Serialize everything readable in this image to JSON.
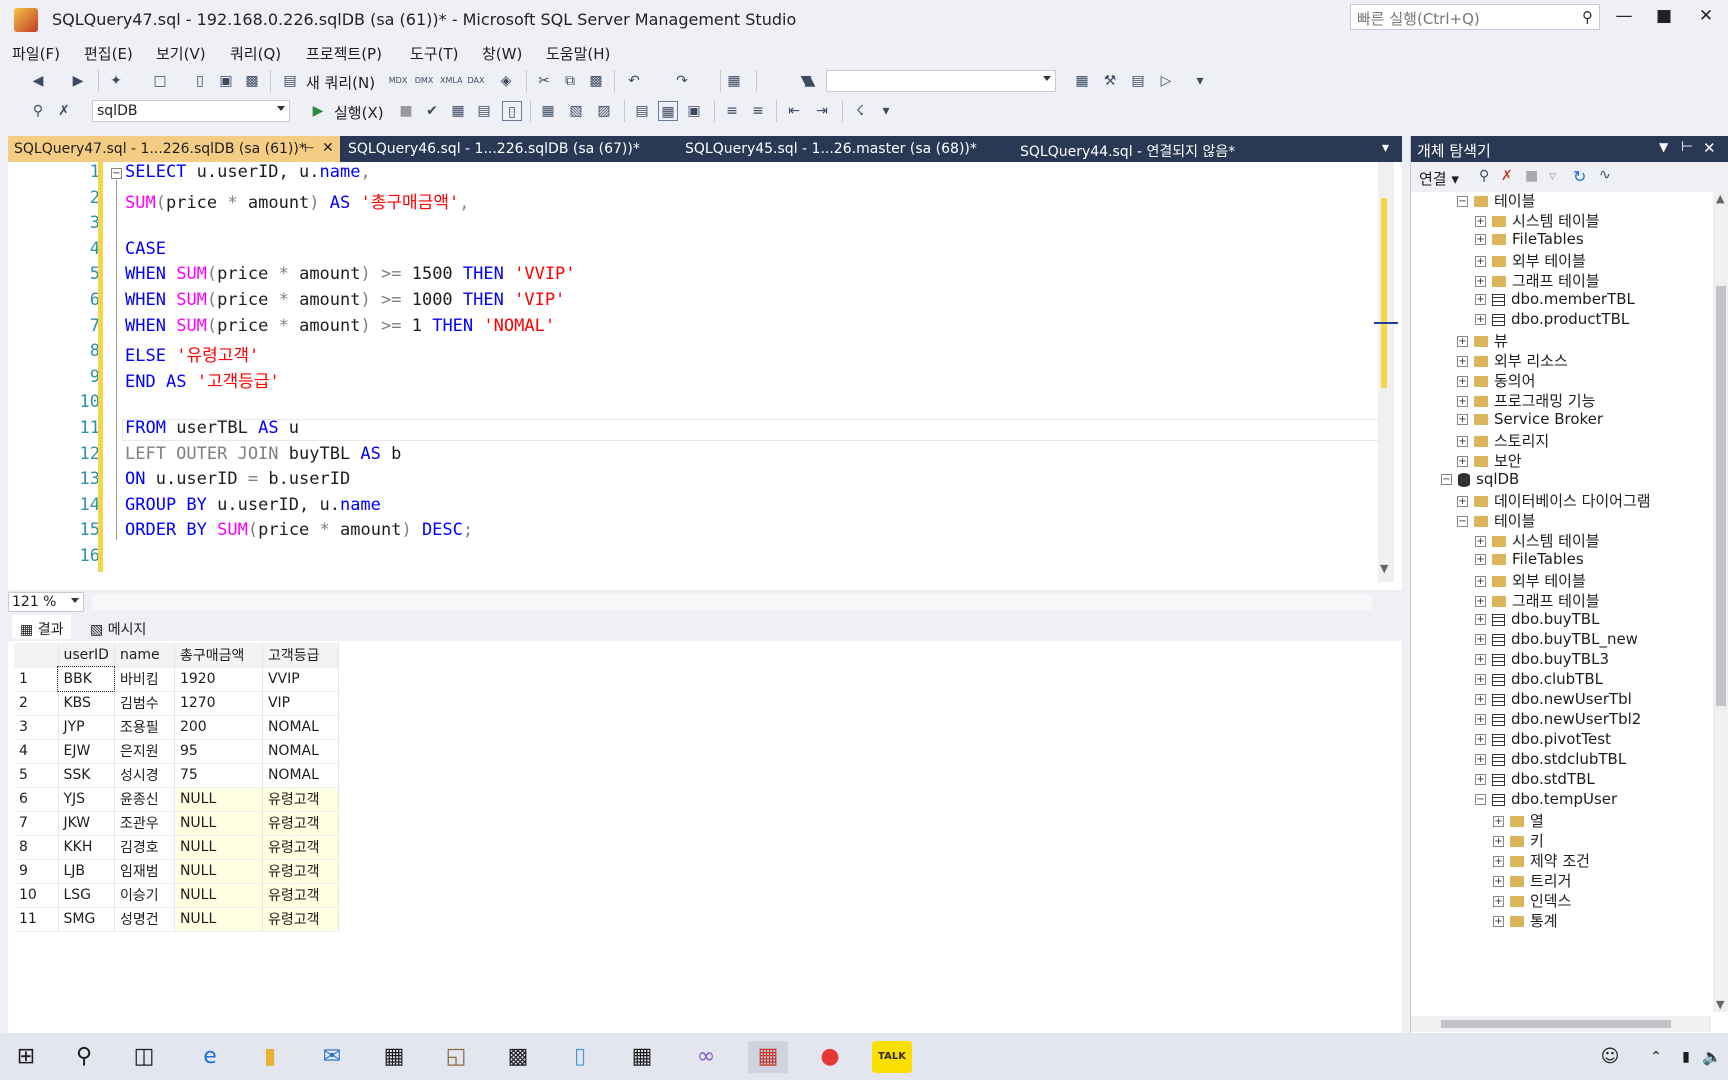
{
  "window": {
    "title": "SQLQuery47.sql - 192.168.0.226.sqlDB (sa (61))* - Microsoft SQL Server Management Studio",
    "quick_launch_placeholder": "빠른 실행(Ctrl+Q)"
  },
  "menu": [
    "파일(F)",
    "편집(E)",
    "보기(V)",
    "쿼리(Q)",
    "프로젝트(P)",
    "도구(T)",
    "창(W)",
    "도움말(H)"
  ],
  "toolbar": {
    "new_query": "새 쿼리(N)",
    "db_combo": "sqlDB",
    "execute": "실행(X)",
    "icons": {
      "mdx": "MDX",
      "dmx": "DMX",
      "xmla": "XMLA",
      "dax": "DAX"
    }
  },
  "tabs": [
    {
      "label": "SQLQuery47.sql - 1...226.sqlDB (sa (61))*",
      "active": true
    },
    {
      "label": "SQLQuery46.sql - 1...226.sqlDB (sa (67))*",
      "active": false
    },
    {
      "label": "SQLQuery45.sql - 1...26.master (sa (68))*",
      "active": false
    },
    {
      "label": "SQLQuery44.sql - 연결되지 않음*",
      "active": false
    }
  ],
  "editor": {
    "line_numbers": [
      "1",
      "2",
      "3",
      "4",
      "5",
      "6",
      "7",
      "8",
      "9",
      "10",
      "11",
      "12",
      "13",
      "14",
      "15",
      "16"
    ],
    "zoom": "121 %",
    "lines": [
      [
        [
          "kw",
          "SELECT"
        ],
        [
          "n",
          " u.userID, u."
        ],
        [
          "kw",
          "name"
        ],
        [
          "gr",
          ","
        ]
      ],
      [
        [
          "fn",
          "SUM"
        ],
        [
          "gr",
          "("
        ],
        [
          "n",
          "price "
        ],
        [
          "gr",
          "*"
        ],
        [
          "n",
          " amount"
        ],
        [
          "gr",
          ")"
        ],
        [
          "n",
          " "
        ],
        [
          "kw",
          "AS"
        ],
        [
          "n",
          " "
        ],
        [
          "str",
          "'총구매금액'"
        ],
        [
          "gr",
          ","
        ]
      ],
      [],
      [
        [
          "kw",
          "CASE"
        ]
      ],
      [
        [
          "kw",
          "WHEN"
        ],
        [
          "n",
          " "
        ],
        [
          "fn",
          "SUM"
        ],
        [
          "gr",
          "("
        ],
        [
          "n",
          "price "
        ],
        [
          "gr",
          "*"
        ],
        [
          "n",
          " amount"
        ],
        [
          "gr",
          ")"
        ],
        [
          "n",
          " "
        ],
        [
          "gr",
          ">="
        ],
        [
          "n",
          " 1500 "
        ],
        [
          "kw",
          "THEN"
        ],
        [
          "n",
          " "
        ],
        [
          "str",
          "'VVIP'"
        ]
      ],
      [
        [
          "kw",
          "WHEN"
        ],
        [
          "n",
          " "
        ],
        [
          "fn",
          "SUM"
        ],
        [
          "gr",
          "("
        ],
        [
          "n",
          "price "
        ],
        [
          "gr",
          "*"
        ],
        [
          "n",
          " amount"
        ],
        [
          "gr",
          ")"
        ],
        [
          "n",
          " "
        ],
        [
          "gr",
          ">="
        ],
        [
          "n",
          " 1000 "
        ],
        [
          "kw",
          "THEN"
        ],
        [
          "n",
          " "
        ],
        [
          "str",
          "'VIP'"
        ]
      ],
      [
        [
          "kw",
          "WHEN"
        ],
        [
          "n",
          " "
        ],
        [
          "fn",
          "SUM"
        ],
        [
          "gr",
          "("
        ],
        [
          "n",
          "price "
        ],
        [
          "gr",
          "*"
        ],
        [
          "n",
          " amount"
        ],
        [
          "gr",
          ")"
        ],
        [
          "n",
          " "
        ],
        [
          "gr",
          ">="
        ],
        [
          "n",
          " 1 "
        ],
        [
          "kw",
          "THEN"
        ],
        [
          "n",
          " "
        ],
        [
          "str",
          "'NOMAL'"
        ]
      ],
      [
        [
          "kw",
          "ELSE"
        ],
        [
          "n",
          " "
        ],
        [
          "str",
          "'유령고객'"
        ]
      ],
      [
        [
          "kw",
          "END"
        ],
        [
          "n",
          " "
        ],
        [
          "kw",
          "AS"
        ],
        [
          "n",
          " "
        ],
        [
          "str",
          "'고객등급'"
        ]
      ],
      [],
      [
        [
          "kw",
          "FROM"
        ],
        [
          "n",
          " userTBL "
        ],
        [
          "kw",
          "AS"
        ],
        [
          "n",
          " u"
        ]
      ],
      [
        [
          "gr",
          "LEFT OUTER JOIN"
        ],
        [
          "n",
          " buyTBL "
        ],
        [
          "kw",
          "AS"
        ],
        [
          "n",
          " b"
        ]
      ],
      [
        [
          "kw",
          "ON"
        ],
        [
          "n",
          " u.userID "
        ],
        [
          "gr",
          "="
        ],
        [
          "n",
          " b.userID"
        ]
      ],
      [
        [
          "kw",
          "GROUP BY"
        ],
        [
          "n",
          " u.userID, u."
        ],
        [
          "kw",
          "name"
        ]
      ],
      [
        [
          "kw",
          "ORDER BY"
        ],
        [
          "n",
          " "
        ],
        [
          "fn",
          "SUM"
        ],
        [
          "gr",
          "("
        ],
        [
          "n",
          "price "
        ],
        [
          "gr",
          "*"
        ],
        [
          "n",
          " amount"
        ],
        [
          "gr",
          ")"
        ],
        [
          "n",
          " "
        ],
        [
          "kw",
          "DESC"
        ],
        [
          "gr",
          ";"
        ]
      ],
      []
    ]
  },
  "results": {
    "tab_results": "결과",
    "tab_messages": "메시지",
    "columns": [
      "userID",
      "name",
      "총구매금액",
      "고객등급"
    ],
    "rows": [
      [
        "1",
        "BBK",
        "바비킴",
        "1920",
        "VVIP"
      ],
      [
        "2",
        "KBS",
        "김범수",
        "1270",
        "VIP"
      ],
      [
        "3",
        "JYP",
        "조용필",
        "200",
        "NOMAL"
      ],
      [
        "4",
        "EJW",
        "은지원",
        "95",
        "NOMAL"
      ],
      [
        "5",
        "SSK",
        "성시경",
        "75",
        "NOMAL"
      ],
      [
        "6",
        "YJS",
        "윤종신",
        "NULL",
        "유령고객"
      ],
      [
        "7",
        "JKW",
        "조관우",
        "NULL",
        "유령고객"
      ],
      [
        "8",
        "KKH",
        "김경호",
        "NULL",
        "유령고객"
      ],
      [
        "9",
        "LJB",
        "임재범",
        "NULL",
        "유령고객"
      ],
      [
        "10",
        "LSG",
        "이승기",
        "NULL",
        "유령고객"
      ],
      [
        "11",
        "SMG",
        "성명건",
        "NULL",
        "유령고객"
      ]
    ]
  },
  "object_explorer": {
    "title": "개체 탐색기",
    "connect": "연결",
    "tree": [
      {
        "label": "테이블",
        "icon": "folder",
        "level": 2,
        "expanded": true
      },
      {
        "label": "시스템 테이블",
        "icon": "folder",
        "level": 3
      },
      {
        "label": "FileTables",
        "icon": "folder",
        "level": 3
      },
      {
        "label": "외부 테이블",
        "icon": "folder",
        "level": 3
      },
      {
        "label": "그래프 테이블",
        "icon": "folder",
        "level": 3
      },
      {
        "label": "dbo.memberTBL",
        "icon": "table",
        "level": 3
      },
      {
        "label": "dbo.productTBL",
        "icon": "table",
        "level": 3
      },
      {
        "label": "뷰",
        "icon": "folder",
        "level": 2
      },
      {
        "label": "외부 리소스",
        "icon": "folder",
        "level": 2
      },
      {
        "label": "동의어",
        "icon": "folder",
        "level": 2
      },
      {
        "label": "프로그래밍 기능",
        "icon": "folder",
        "level": 2
      },
      {
        "label": "Service Broker",
        "icon": "folder",
        "level": 2
      },
      {
        "label": "스토리지",
        "icon": "folder",
        "level": 2
      },
      {
        "label": "보안",
        "icon": "folder",
        "level": 2
      },
      {
        "label": "sqlDB",
        "icon": "db",
        "level": 1,
        "expanded": true
      },
      {
        "label": "데이터베이스 다이어그램",
        "icon": "folder",
        "level": 2
      },
      {
        "label": "테이블",
        "icon": "folder",
        "level": 2,
        "expanded": true
      },
      {
        "label": "시스템 테이블",
        "icon": "folder",
        "level": 3
      },
      {
        "label": "FileTables",
        "icon": "folder",
        "level": 3
      },
      {
        "label": "외부 테이블",
        "icon": "folder",
        "level": 3
      },
      {
        "label": "그래프 테이블",
        "icon": "folder",
        "level": 3
      },
      {
        "label": "dbo.buyTBL",
        "icon": "table",
        "level": 3
      },
      {
        "label": "dbo.buyTBL_new",
        "icon": "table",
        "level": 3
      },
      {
        "label": "dbo.buyTBL3",
        "icon": "table",
        "level": 3
      },
      {
        "label": "dbo.clubTBL",
        "icon": "table",
        "level": 3
      },
      {
        "label": "dbo.newUserTbl",
        "icon": "table",
        "level": 3
      },
      {
        "label": "dbo.newUserTbl2",
        "icon": "table",
        "level": 3
      },
      {
        "label": "dbo.pivotTest",
        "icon": "table",
        "level": 3
      },
      {
        "label": "dbo.stdclubTBL",
        "icon": "table",
        "level": 3
      },
      {
        "label": "dbo.stdTBL",
        "icon": "table",
        "level": 3
      },
      {
        "label": "dbo.tempUser",
        "icon": "table",
        "level": 3,
        "expanded": true
      },
      {
        "label": "열",
        "icon": "folder",
        "level": 4
      },
      {
        "label": "키",
        "icon": "folder",
        "level": 4
      },
      {
        "label": "제약 조건",
        "icon": "folder",
        "level": 4
      },
      {
        "label": "트리거",
        "icon": "folder",
        "level": 4
      },
      {
        "label": "인덱스",
        "icon": "folder",
        "level": 4
      },
      {
        "label": "통계",
        "icon": "folder",
        "level": 4
      }
    ]
  },
  "taskbar": {
    "kakao_label": "TALK"
  }
}
